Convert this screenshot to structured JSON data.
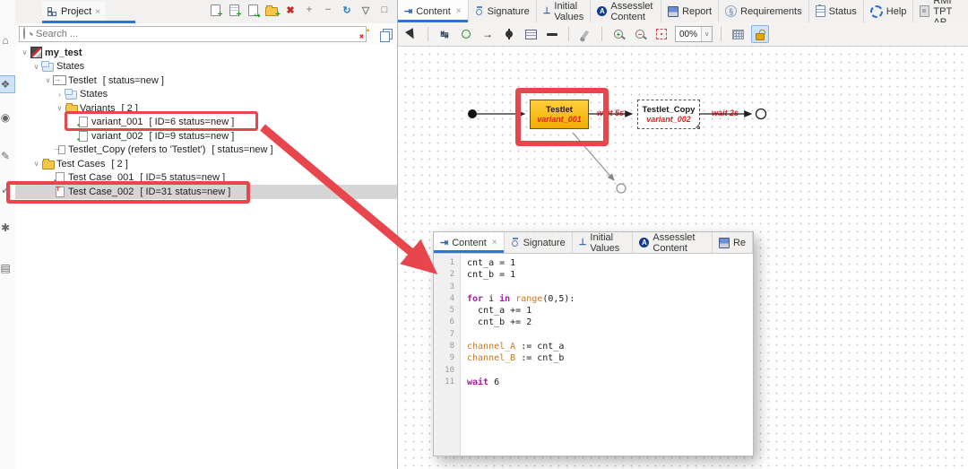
{
  "colors": {
    "annotation_red": "#e8464d",
    "accent_blue": "#2e74d6",
    "testlet_fill": "#f2ac00",
    "variant_text": "#e02020",
    "selection_gray": "#d5d5d5"
  },
  "left_rail": {
    "icons": [
      {
        "name": "home-icon",
        "glyph": "⌂",
        "selected": false
      },
      {
        "name": "project-view-icon",
        "glyph": "❖",
        "selected": true
      },
      {
        "name": "link-icon",
        "glyph": "◉",
        "selected": false
      },
      {
        "name": "edit-icon",
        "glyph": "✎",
        "selected": false
      },
      {
        "name": "check-icon",
        "glyph": "✓",
        "selected": false
      },
      {
        "name": "tools-icon",
        "glyph": "✱",
        "selected": false
      },
      {
        "name": "image-icon",
        "glyph": "▤",
        "selected": false
      }
    ]
  },
  "project_panel": {
    "tab_label": "Project",
    "tab_close": "×",
    "toolbar": [
      {
        "name": "new-file-icon",
        "kind": "page-plus"
      },
      {
        "name": "new-testlet-icon",
        "kind": "page-lines-plus"
      },
      {
        "name": "import-icon",
        "kind": "page-import"
      },
      {
        "name": "new-folder-icon",
        "kind": "folder-plus"
      },
      {
        "name": "delete-icon",
        "kind": "glyph",
        "glyph": "✖",
        "color": "#c22828"
      },
      {
        "name": "expand-all-icon",
        "kind": "glyph",
        "glyph": "+",
        "color": "#999999"
      },
      {
        "name": "collapse-all-icon",
        "kind": "glyph",
        "glyph": "−",
        "color": "#999999"
      },
      {
        "name": "refresh-icon",
        "kind": "glyph",
        "glyph": "↻",
        "color": "#2e7bd6"
      },
      {
        "name": "dropdown-icon",
        "kind": "glyph",
        "glyph": "▽",
        "color": "#777777"
      },
      {
        "name": "maximize-icon",
        "kind": "glyph",
        "glyph": "□",
        "color": "#666666"
      }
    ],
    "search": {
      "placeholder": "Search ..."
    },
    "search_icons": [
      {
        "name": "filter-icon",
        "kind": "filter"
      },
      {
        "name": "duplicates-icon",
        "kind": "layers"
      }
    ],
    "tree": [
      {
        "name": "my_test",
        "meta": "",
        "level": 0,
        "icon": "tpt-project-icon",
        "expander": "open",
        "bold": true,
        "selected": false,
        "outlined": false
      },
      {
        "name": "States",
        "meta": "",
        "level": 1,
        "icon": "states-icon",
        "expander": "open",
        "bold": false,
        "selected": false,
        "outlined": false
      },
      {
        "name": "Testlet",
        "meta": "[ status=new ]",
        "level": 2,
        "icon": "testlet-icon",
        "expander": "open",
        "bold": false,
        "selected": false,
        "outlined": false
      },
      {
        "name": "States",
        "meta": "",
        "level": 3,
        "icon": "states-icon",
        "expander": "closed",
        "bold": false,
        "selected": false,
        "outlined": false
      },
      {
        "name": "Variants",
        "meta": "[ 2 ]",
        "level": 3,
        "icon": "folder-icon",
        "expander": "open",
        "bold": false,
        "selected": false,
        "outlined": false
      },
      {
        "name": "variant_001",
        "meta": "[ ID=6 status=new ]",
        "level": 4,
        "icon": "variant-icon",
        "expander": "none",
        "bold": false,
        "selected": false,
        "outlined": true
      },
      {
        "name": "variant_002",
        "meta": "[ ID=9 status=new ]",
        "level": 4,
        "icon": "variant-icon",
        "expander": "none",
        "bold": false,
        "selected": false,
        "outlined": false
      },
      {
        "name": "Testlet_Copy (refers to 'Testlet')",
        "meta": "[ status=new ]",
        "level": 2,
        "icon": "testlet-copy-icon",
        "expander": "none",
        "bold": false,
        "selected": false,
        "outlined": false
      },
      {
        "name": "Test Cases",
        "meta": "[ 2 ]",
        "level": 1,
        "icon": "folder-icon",
        "expander": "open",
        "bold": false,
        "selected": false,
        "outlined": false
      },
      {
        "name": "Test Case_001",
        "meta": "[ ID=5 status=new ]",
        "level": 2,
        "icon": "testcase-icon",
        "expander": "none",
        "bold": false,
        "selected": false,
        "outlined": false
      },
      {
        "name": "Test Case_002",
        "meta": "[ ID=31 status=new ]",
        "level": 2,
        "icon": "testcase2-icon",
        "expander": "none",
        "bold": false,
        "selected": true,
        "outlined": true
      }
    ]
  },
  "main_tabs": [
    {
      "label": "Content",
      "icon": "content-icon",
      "active": true,
      "closable": true
    },
    {
      "label": "Signature",
      "icon": "signature-icon",
      "active": false,
      "closable": false
    },
    {
      "label": "Initial Values",
      "icon": "initial-values-icon",
      "active": false,
      "closable": false
    },
    {
      "label": "Assesslet Content",
      "icon": "assesslet-icon",
      "active": false,
      "closable": false
    },
    {
      "label": "Report",
      "icon": "report-icon",
      "active": false,
      "closable": false
    },
    {
      "label": "Requirements",
      "icon": "requirements-icon",
      "active": false,
      "closable": false
    },
    {
      "label": "Status",
      "icon": "status-icon",
      "active": false,
      "closable": false
    },
    {
      "label": "Help",
      "icon": "help-icon",
      "active": false,
      "closable": false
    },
    {
      "label": "RMI TPT AP",
      "icon": "rmi-icon",
      "active": false,
      "closable": false
    }
  ],
  "diagram_toolbar": {
    "zoom_value": "00%",
    "groups": [
      [
        "select-tool-icon"
      ],
      [
        "state-tool-icon",
        "junction-tool-icon",
        "transition-tool-icon",
        "final-state-tool-icon",
        "textbox-tool-icon",
        "line-tool-icon"
      ],
      [
        "format-brush-icon"
      ],
      [
        "zoom-in-icon",
        "zoom-out-icon",
        "zoom-fit-icon",
        "zoom-combo"
      ],
      [
        "grid-icon",
        "lock-icon"
      ]
    ]
  },
  "diagram": {
    "testlet": {
      "title": "Testlet",
      "variant": "variant_001"
    },
    "testlet_copy": {
      "title": "Testlet_Copy",
      "variant": "variant_002"
    },
    "transition1_label": "wait 5s",
    "transition2_label": "wait 2s"
  },
  "overlay": {
    "tabs": [
      {
        "label": "Content",
        "icon": "content-icon",
        "active": true,
        "closable": true
      },
      {
        "label": "Signature",
        "icon": "signature-icon",
        "active": false,
        "closable": false
      },
      {
        "label": "Initial Values",
        "icon": "initial-values-icon",
        "active": false,
        "closable": false
      },
      {
        "label": "Assesslet Content",
        "icon": "assesslet-icon",
        "active": false,
        "closable": false
      },
      {
        "label": "Re",
        "icon": "report-icon",
        "active": false,
        "closable": false
      }
    ],
    "code": {
      "lines": [
        {
          "n": "1",
          "tokens": [
            {
              "t": "cnt_a = 1",
              "c": "p"
            }
          ]
        },
        {
          "n": "2",
          "tokens": [
            {
              "t": "cnt_b = 1",
              "c": "p"
            }
          ]
        },
        {
          "n": "3",
          "tokens": []
        },
        {
          "n": "4",
          "tokens": [
            {
              "t": "for",
              "c": "k"
            },
            {
              "t": " i ",
              "c": "p"
            },
            {
              "t": "in",
              "c": "k"
            },
            {
              "t": " ",
              "c": "p"
            },
            {
              "t": "range",
              "c": "f"
            },
            {
              "t": "(0,5):",
              "c": "p"
            }
          ]
        },
        {
          "n": "5",
          "tokens": [
            {
              "t": "  cnt_a += 1",
              "c": "p"
            }
          ]
        },
        {
          "n": "6",
          "tokens": [
            {
              "t": "  cnt_b += 2",
              "c": "p"
            }
          ]
        },
        {
          "n": "7",
          "tokens": []
        },
        {
          "n": "8",
          "tokens": [
            {
              "t": "channel_A",
              "c": "f"
            },
            {
              "t": " := cnt_a",
              "c": "p"
            }
          ]
        },
        {
          "n": "9",
          "tokens": [
            {
              "t": "channel_B",
              "c": "f"
            },
            {
              "t": " := cnt_b",
              "c": "p"
            }
          ]
        },
        {
          "n": "10",
          "tokens": []
        },
        {
          "n": "11",
          "tokens": [
            {
              "t": "wait",
              "c": "k"
            },
            {
              "t": " 6",
              "c": "p"
            }
          ]
        }
      ]
    }
  }
}
